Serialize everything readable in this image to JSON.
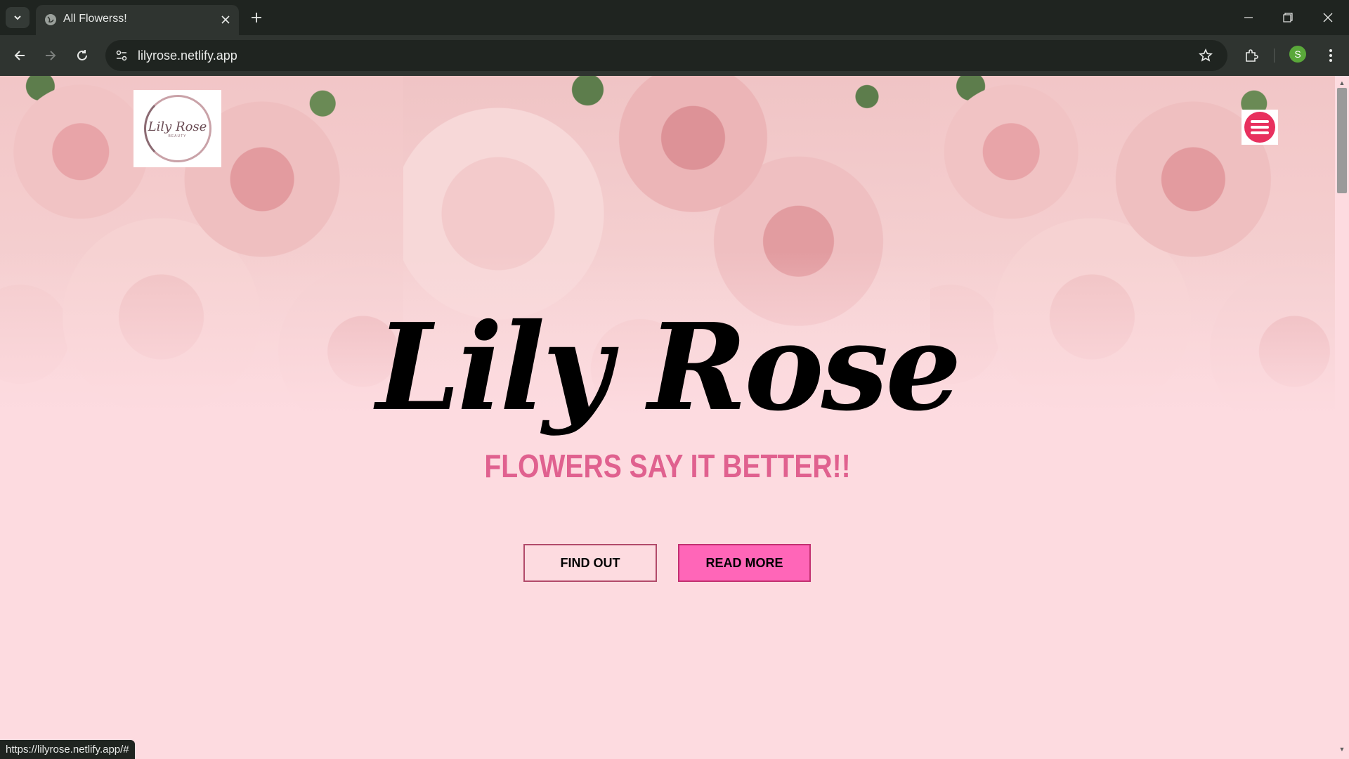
{
  "browser": {
    "tab_title": "All Flowerss!",
    "url": "lilyrose.netlify.app",
    "profile_initial": "S",
    "status_url": "https://lilyrose.netlify.app/#"
  },
  "page": {
    "logo_text": "Lily Rose",
    "logo_subtext": "BEAUTY",
    "brand_title": "Lily Rose",
    "tagline": "FLOWERS SAY IT BETTER!!",
    "buttons": {
      "find_out": "FIND OUT",
      "read_more": "READ MORE"
    }
  },
  "colors": {
    "page_background": "#fddbe0",
    "tagline": "#e0618f",
    "read_more_fill": "#ff66b8",
    "menu_button": "#e8305e"
  },
  "icons": [
    "tab-search-icon",
    "globe-icon",
    "close-icon",
    "plus-icon",
    "minimize-icon",
    "restore-icon",
    "window-close-icon",
    "back-icon",
    "forward-icon",
    "reload-icon",
    "site-info-icon",
    "star-icon",
    "extensions-icon",
    "more-icon",
    "hamburger-icon"
  ]
}
